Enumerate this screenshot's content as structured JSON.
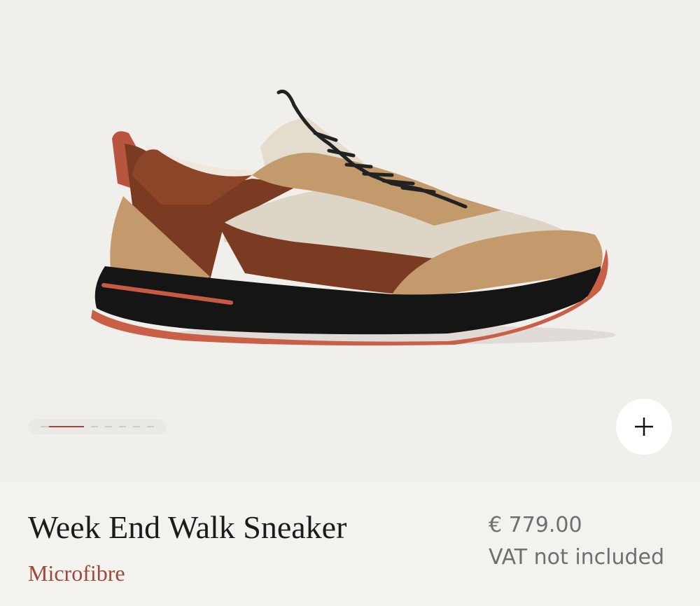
{
  "product": {
    "name": "Week End Walk Sneaker",
    "material": "Microfibre",
    "price": "€ 779.00",
    "vat_note": "VAT not included"
  },
  "gallery": {
    "image_subject": "sneaker-side-view",
    "slide_count": 7,
    "active_slide": 1,
    "zoom_icon": "plus-icon"
  },
  "colors": {
    "accent": "#9c4a3c",
    "background": "#f1efec",
    "text": "#1b1b1b",
    "muted_text": "#6f6f6f"
  }
}
